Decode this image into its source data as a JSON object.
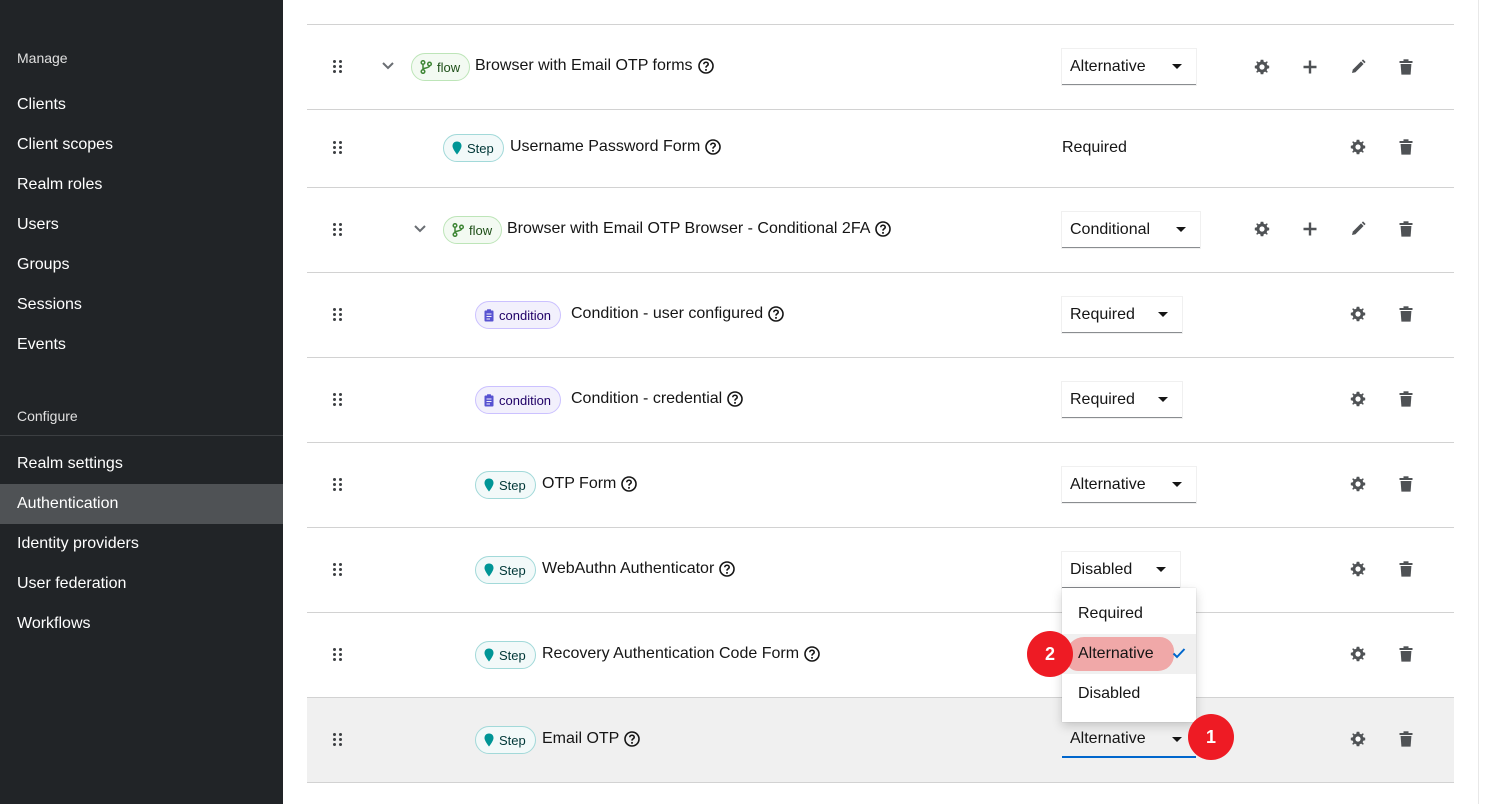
{
  "sidebar": {
    "manage_heading": "Manage",
    "configure_heading": "Configure",
    "manage_items": [
      {
        "label": "Clients"
      },
      {
        "label": "Client scopes"
      },
      {
        "label": "Realm roles"
      },
      {
        "label": "Users"
      },
      {
        "label": "Groups"
      },
      {
        "label": "Sessions"
      },
      {
        "label": "Events"
      }
    ],
    "configure_items": [
      {
        "label": "Realm settings"
      },
      {
        "label": "Authentication",
        "active": true
      },
      {
        "label": "Identity providers"
      },
      {
        "label": "User federation"
      },
      {
        "label": "Workflows"
      }
    ]
  },
  "flow_table": {
    "rows": [
      {
        "type_label": "flow",
        "name": "Browser with Email OTP forms",
        "requirement": "Alternative"
      },
      {
        "type_label": "Step",
        "name": "Username Password Form",
        "requirement": "Required"
      },
      {
        "type_label": "flow",
        "name": "Browser with Email OTP Browser - Conditional 2FA",
        "requirement": "Conditional"
      },
      {
        "type_label": "condition",
        "name": "Condition - user configured",
        "requirement": "Required"
      },
      {
        "type_label": "condition",
        "name": "Condition - credential",
        "requirement": "Required"
      },
      {
        "type_label": "Step",
        "name": "OTP Form",
        "requirement": "Alternative"
      },
      {
        "type_label": "Step",
        "name": "WebAuthn Authenticator",
        "requirement": "Disabled"
      },
      {
        "type_label": "Step",
        "name": "Recovery Authentication Code Form",
        "requirement": ""
      },
      {
        "type_label": "Step",
        "name": "Email OTP",
        "requirement": "Alternative"
      }
    ]
  },
  "requirement_menu": {
    "options": [
      "Required",
      "Alternative",
      "Disabled"
    ],
    "selected": "Alternative"
  },
  "callouts": {
    "one": "1",
    "two": "2"
  },
  "colors": {
    "sidebar_bg": "#212427",
    "active_nav": "#4f5255",
    "callout": "#ee1b24",
    "focus_blue": "#0066cc",
    "highlight_mark": "#f06e6e"
  },
  "icons": {
    "drag": "drag-handle-icon",
    "expand": "chevron-down-icon",
    "flow": "code-branch-icon",
    "step": "map-marker-icon",
    "condition": "clipboard-icon",
    "help": "question-circle-icon",
    "settings": "gear-icon",
    "add": "plus-icon",
    "edit": "pencil-icon",
    "delete": "trash-icon",
    "selected": "check-icon"
  }
}
